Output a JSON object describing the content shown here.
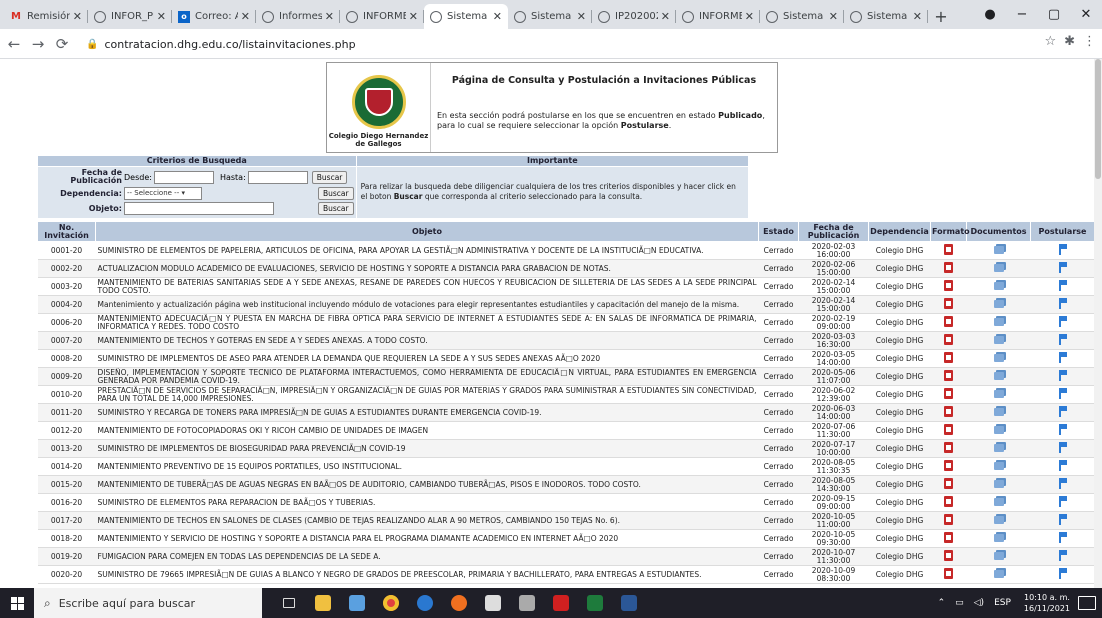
{
  "browser": {
    "tabs": [
      {
        "label": "Remisión | ",
        "icon": "gmail-icon"
      },
      {
        "label": "INFOR_PR",
        "icon": "globe-icon"
      },
      {
        "label": "Correo: Al",
        "icon": "outlook-icon"
      },
      {
        "label": "Informes I",
        "icon": "globe-icon"
      },
      {
        "label": "INFORME",
        "icon": "globe-icon"
      },
      {
        "label": "Sistema d",
        "icon": "globe-icon",
        "active": true
      },
      {
        "label": "Sistema d",
        "icon": "globe-icon"
      },
      {
        "label": "IP2020020",
        "icon": "globe-icon"
      },
      {
        "label": "INFORME",
        "icon": "globe-icon"
      },
      {
        "label": "Sistema d",
        "icon": "globe-icon"
      },
      {
        "label": "Sistema d",
        "icon": "globe-icon"
      }
    ],
    "new_tab": "+",
    "url": "contratacion.dhg.edu.co/listainvitaciones.php"
  },
  "header": {
    "title": "Página de Consulta y Postulación a Invitaciones Públicas",
    "logo_caption": "Colegio Diego Hernandez de Gallegos",
    "intro_1": "En esta sección podrá postularse en los que se encuentren en estado ",
    "intro_bold_1": "Publicado",
    "intro_2": ", para lo cual se requiere seleccionar la opción ",
    "intro_bold_2": "Postularse",
    "intro_3": "."
  },
  "criteria": {
    "heading": "Criterios de Busqueda",
    "fecha_label": "Fecha de Publicación",
    "desde_label": "Desde:",
    "hasta_label": "Hasta:",
    "dependencia_label": "Dependencia:",
    "dependencia_value": "-- Seleccione --",
    "objeto_label": "Objeto:",
    "search_button": "Buscar",
    "important_heading": "Importante",
    "important_1": "Para relizar la busqueda debe diligenciar cualquiera de los tres criterios disponibles y hacer click en el boton ",
    "important_bold": "Buscar",
    "important_2": " que corresponda al criterio seleccionado para la consulta."
  },
  "table": {
    "columns": {
      "num": "No. Invitación",
      "objeto": "Objeto",
      "estado": "Estado",
      "fecha": "Fecha de Publicación",
      "dependencia": "Dependencia",
      "formato": "Formato",
      "documentos": "Documentos",
      "postularse": "Postularse"
    },
    "rows": [
      {
        "num": "0001-20",
        "objeto": "SUMINISTRO DE ELEMENTOS DE PAPELERIA, ARTICULOS DE OFICINA, PARA APOYAR LA GESTIÃ□N ADMINISTRATIVA Y DOCENTE DE LA INSTITUCIÃ□N EDUCATIVA.",
        "estado": "Cerrado",
        "fecha": "2020-02-03",
        "hora": "16:00:00",
        "dependencia": "Colegio DHG"
      },
      {
        "num": "0002-20",
        "objeto": "ACTUALIZACION MODULO ACADEMICO DE EVALUACIONES, SERVICIO DE HOSTING Y SOPORTE A DISTANCIA PARA GRABACION DE NOTAS.",
        "estado": "Cerrado",
        "fecha": "2020-02-06",
        "hora": "15:00:00",
        "dependencia": "Colegio DHG"
      },
      {
        "num": "0003-20",
        "objeto": "MANTENIMIENTO DE BATERIAS SANITARIAS SEDE A Y SEDE ANEXAS, RESANE DE PAREDES CON HUECOS Y REUBICACION DE SILLETERIA DE LAS SEDES A LA SEDE PRINCIPAL TODO COSTO.",
        "estado": "Cerrado",
        "fecha": "2020-02-14",
        "hora": "15:00:00",
        "dependencia": "Colegio DHG"
      },
      {
        "num": "0004-20",
        "objeto": "Mantenimiento y actualización página web institucional incluyendo módulo de votaciones para elegir representantes estudiantiles y capacitación del manejo de la misma.",
        "estado": "Cerrado",
        "fecha": "2020-02-14",
        "hora": "15:00:00",
        "dependencia": "Colegio DHG"
      },
      {
        "num": "0006-20",
        "objeto": "MANTENIMIENTO ADECUACIÃ□N Y PUESTA EN MARCHA DE FIBRA OPTICA PARA SERVICIO DE INTERNET A ESTUDIANTES SEDE A: EN SALAS DE INFORMATICA DE PRIMARIA, INFORMATICA Y REDES. TODO COSTO",
        "estado": "Cerrado",
        "fecha": "2020-02-19",
        "hora": "09:00:00",
        "dependencia": "Colegio DHG"
      },
      {
        "num": "0007-20",
        "objeto": "MANTENIMIENTO DE TECHOS Y GOTERAS EN SEDE A Y SEDES ANEXAS. A TODO COSTO.",
        "estado": "Cerrado",
        "fecha": "2020-03-03",
        "hora": "16:30:00",
        "dependencia": "Colegio DHG"
      },
      {
        "num": "0008-20",
        "objeto": "SUMINISTRO DE IMPLEMENTOS DE ASEO PARA ATENDER LA DEMANDA QUE REQUIEREN LA SEDE A Y SUS SEDES ANEXAS AÃ□O 2020",
        "estado": "Cerrado",
        "fecha": "2020-03-05",
        "hora": "14:00:00",
        "dependencia": "Colegio DHG"
      },
      {
        "num": "0009-20",
        "objeto": "DISEÑO, IMPLEMENTACION Y SOPORTE TECNICO DE PLATAFORMA INTERACTUEMOS, COMO HERRAMIENTA DE EDUCACIÃ□N VIRTUAL, PARA ESTUDIANTES EN EMERGENCIA GENERADA POR PANDEMIA COVID-19.",
        "estado": "Cerrado",
        "fecha": "2020-05-06",
        "hora": "11:07:00",
        "dependencia": "Colegio DHG"
      },
      {
        "num": "0010-20",
        "objeto": "PRESTACIÃ□N DE SERVICIOS DE SEPARACIÃ□N, IMPRESIÃ□N Y ORGANIZACIÃ□N DE GUIAS POR MATERIAS Y GRADOS PARA SUMINISTRAR A ESTUDIANTES SIN CONECTIVIDAD, PARA UN TOTAL DE 14,000 IMPRESIONES.",
        "estado": "Cerrado",
        "fecha": "2020-06-02",
        "hora": "12:39:00",
        "dependencia": "Colegio DHG"
      },
      {
        "num": "0011-20",
        "objeto": "SUMINISTRO Y RECARGA DE TONERS PARA IMPRESIÃ□N DE GUIAS A ESTUDIANTES DURANTE EMERGENCIA COVID-19.",
        "estado": "Cerrado",
        "fecha": "2020-06-03",
        "hora": "14:00:00",
        "dependencia": "Colegio DHG"
      },
      {
        "num": "0012-20",
        "objeto": "MANTENIMIENTO DE FOTOCOPIADORAS OKI Y RICOH CAMBIO DE UNIDADES DE IMAGEN",
        "estado": "Cerrado",
        "fecha": "2020-07-06",
        "hora": "11:30:00",
        "dependencia": "Colegio DHG"
      },
      {
        "num": "0013-20",
        "objeto": "SUMINISTRO DE IMPLEMENTOS DE BIOSEGURIDAD PARA PREVENCIÃ□N COVID-19",
        "estado": "Cerrado",
        "fecha": "2020-07-17",
        "hora": "10:00:00",
        "dependencia": "Colegio DHG"
      },
      {
        "num": "0014-20",
        "objeto": "MANTENIMIENTO PREVENTIVO DE 15 EQUIPOS PORTATILES, USO INSTITUCIONAL.",
        "estado": "Cerrado",
        "fecha": "2020-08-05",
        "hora": "11:30:35",
        "dependencia": "Colegio DHG"
      },
      {
        "num": "0015-20",
        "objeto": "MANTENIMIENTO DE TUBERÃ□AS DE AGUAS NEGRAS EN BAÃ□OS DE AUDITORIO, CAMBIANDO TUBERÃ□AS, PISOS E INODOROS. TODO COSTO.",
        "estado": "Cerrado",
        "fecha": "2020-08-05",
        "hora": "14:30:00",
        "dependencia": "Colegio DHG"
      },
      {
        "num": "0016-20",
        "objeto": "SUMINISTRO DE ELEMENTOS PARA REPARACION DE BAÃ□OS Y TUBERIAS.",
        "estado": "Cerrado",
        "fecha": "2020-09-15",
        "hora": "09:00:00",
        "dependencia": "Colegio DHG"
      },
      {
        "num": "0017-20",
        "objeto": "MANTENIMIENTO DE TECHOS EN SALONES DE CLASES (CAMBIO DE TEJAS REALIZANDO ALAR A 90 METROS, CAMBIANDO 150 TEJAS No. 6).",
        "estado": "Cerrado",
        "fecha": "2020-10-05",
        "hora": "11:00:00",
        "dependencia": "Colegio DHG"
      },
      {
        "num": "0018-20",
        "objeto": "MANTENIMIENTO Y SERVICIO DE HOSTING Y SOPORTE A DISTANCIA PARA EL PROGRAMA DIAMANTE ACADEMICO EN INTERNET AÃ□O 2020",
        "estado": "Cerrado",
        "fecha": "2020-10-05",
        "hora": "09:30:00",
        "dependencia": "Colegio DHG"
      },
      {
        "num": "0019-20",
        "objeto": "FUMIGACION PARA COMEJEN EN TODAS LAS DEPENDENCIAS DE LA SEDE A.",
        "estado": "Cerrado",
        "fecha": "2020-10-07",
        "hora": "11:30:00",
        "dependencia": "Colegio DHG"
      },
      {
        "num": "0020-20",
        "objeto": "SUMINISTRO DE 79665 IMPRESIÃ□N DE GUIAS A BLANCO Y NEGRO DE GRADOS DE PREESCOLAR, PRIMARIA Y BACHILLERATO, PARA ENTREGAS A ESTUDIANTES.",
        "estado": "Cerrado",
        "fecha": "2020-10-09",
        "hora": "08:30:00",
        "dependencia": "Colegio DHG"
      }
    ]
  },
  "taskbar": {
    "search_placeholder": "Escribe aquí para buscar",
    "language": "ESP",
    "time": "10:10 a. m.",
    "date": "16/11/2021"
  },
  "colors": {
    "header_blue": "#b8c8dc",
    "panel_blue": "#dde5ee",
    "pdf_red": "#c62828",
    "flag_blue": "#2c7bd6"
  }
}
